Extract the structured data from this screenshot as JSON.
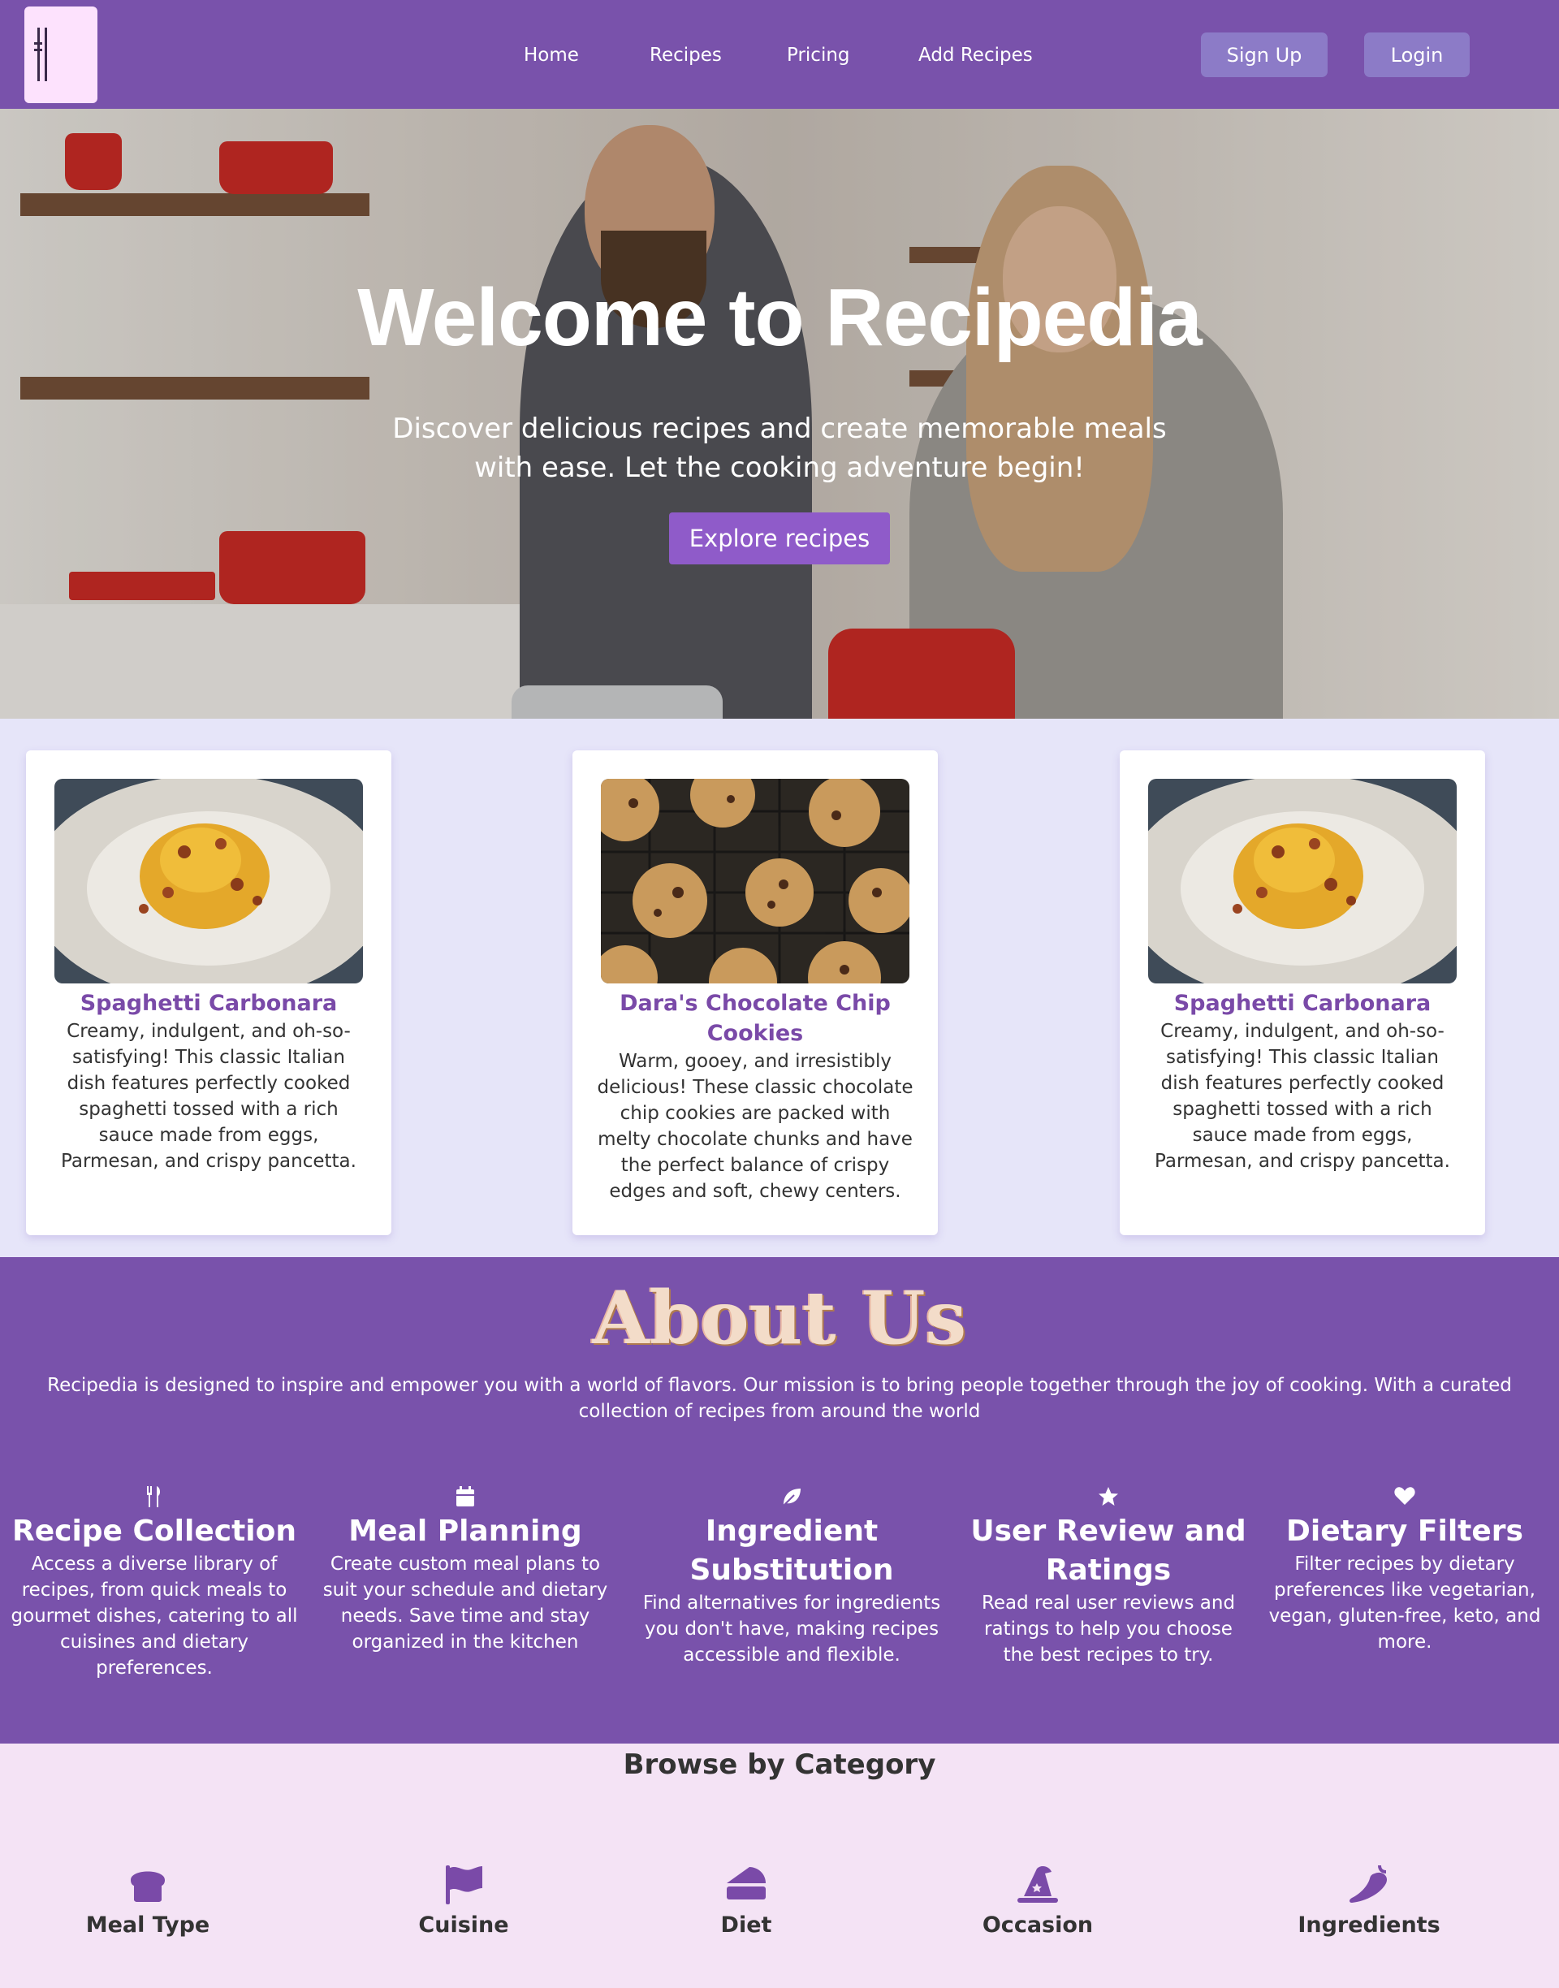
{
  "nav": {
    "links": [
      "Home",
      "Recipes",
      "Pricing",
      "Add Recipes"
    ],
    "signup": "Sign Up",
    "login": "Login"
  },
  "hero": {
    "title": "Welcome to Recipedia",
    "subtitle": "Discover delicious recipes and create memorable meals with ease. Let the cooking adventure begin!",
    "cta": "Explore recipes"
  },
  "cards": [
    {
      "title": "Spaghetti Carbonara",
      "desc": "Creamy, indulgent, and oh-so-satisfying! This classic Italian dish features perfectly cooked spaghetti tossed with a rich sauce made from eggs, Parmesan, and crispy pancetta."
    },
    {
      "title": "Dara's Chocolate Chip Cookies",
      "desc": "Warm, gooey, and irresistibly delicious! These classic chocolate chip cookies are packed with melty chocolate chunks and have the perfect balance of crispy edges and soft, chewy centers."
    },
    {
      "title": "Spaghetti Carbonara",
      "desc": "Creamy, indulgent, and oh-so-satisfying! This classic Italian dish features perfectly cooked spaghetti tossed with a rich sauce made from eggs, Parmesan, and crispy pancetta."
    }
  ],
  "about": {
    "title": "About Us",
    "text": "Recipedia is designed to inspire and empower you with a world of flavors. Our mission is to bring people together through the joy of cooking. With a curated collection of recipes from around the world",
    "features": [
      {
        "icon": "utensils-icon",
        "title": "Recipe Collection",
        "desc": "Access a diverse library of recipes, from quick meals to gourmet dishes, catering to all cuisines and dietary preferences."
      },
      {
        "icon": "calendar-icon",
        "title": "Meal Planning",
        "desc": "Create custom meal plans to suit your schedule and dietary needs. Save time and stay organized in the kitchen"
      },
      {
        "icon": "leaf-icon",
        "title": "Ingredient Substitution",
        "desc": "Find alternatives for ingredients you don't have, making recipes accessible and flexible."
      },
      {
        "icon": "star-icon",
        "title": "User Review and Ratings",
        "desc": "Read real user reviews and ratings to help you choose the best recipes to try."
      },
      {
        "icon": "heart-icon",
        "title": "Dietary Filters",
        "desc": "Filter recipes by dietary preferences like vegetarian, vegan, gluten-free, keto, and more."
      }
    ]
  },
  "browse": {
    "title": "Browse by Category",
    "categories": [
      {
        "icon": "bread-icon",
        "label": "Meal Type"
      },
      {
        "icon": "flag-icon",
        "label": "Cuisine"
      },
      {
        "icon": "cake-slice-icon",
        "label": "Diet"
      },
      {
        "icon": "wizard-hat-icon",
        "label": "Occasion"
      },
      {
        "icon": "pepper-icon",
        "label": "Ingredients"
      }
    ]
  },
  "colors": {
    "primary": "#7952ab",
    "button": "#8c7bc7",
    "accent": "#8f5bc9",
    "cards_bg": "#e6e5f9",
    "browse_bg": "#f4e3f5"
  }
}
